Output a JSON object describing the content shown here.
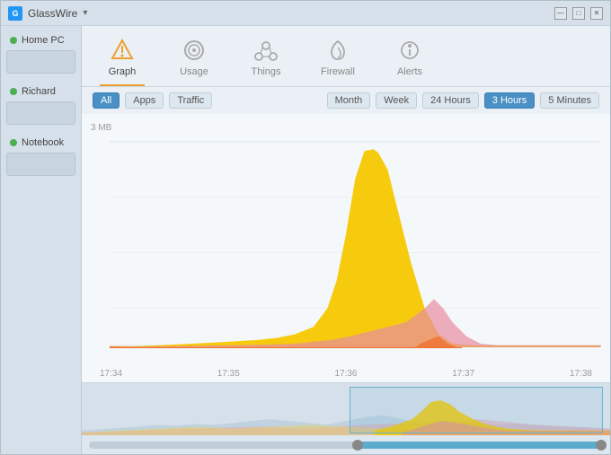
{
  "app": {
    "title": "GlassWire",
    "title_arrow": "▾"
  },
  "titlebar": {
    "minimize_label": "—",
    "maximize_label": "□",
    "close_label": "✕"
  },
  "sidebar": {
    "items": [
      {
        "id": "home-pc",
        "label": "Home PC",
        "status": "green"
      },
      {
        "id": "richard",
        "label": "Richard",
        "status": "green"
      },
      {
        "id": "notebook",
        "label": "Notebook",
        "status": "green"
      }
    ]
  },
  "nav": {
    "tabs": [
      {
        "id": "graph",
        "label": "Graph",
        "icon": "▲",
        "active": true
      },
      {
        "id": "usage",
        "label": "Usage",
        "icon": "◎"
      },
      {
        "id": "things",
        "label": "Things",
        "icon": "⬡"
      },
      {
        "id": "firewall",
        "label": "Firewall",
        "icon": "🔥"
      },
      {
        "id": "alerts",
        "label": "Alerts",
        "icon": "📍"
      }
    ]
  },
  "filters": {
    "type_buttons": [
      {
        "id": "all",
        "label": "All",
        "active": true
      },
      {
        "id": "apps",
        "label": "Apps",
        "active": false
      },
      {
        "id": "traffic",
        "label": "Traffic",
        "active": false
      }
    ],
    "time_buttons": [
      {
        "id": "month",
        "label": "Month",
        "active": false
      },
      {
        "id": "week",
        "label": "Week",
        "active": false
      },
      {
        "id": "24hours",
        "label": "24 Hours",
        "active": false
      },
      {
        "id": "3hours",
        "label": "3 Hours",
        "active": true
      },
      {
        "id": "5minutes",
        "label": "5 Minutes",
        "active": false
      }
    ]
  },
  "chart": {
    "y_label": "3 MB",
    "x_labels": [
      "17:34",
      "17:35",
      "17:36",
      "17:37",
      "17:38"
    ]
  },
  "colors": {
    "accent_orange": "#f0a030",
    "active_blue": "#4a90c4",
    "chart_yellow": "#f5c800",
    "chart_pink": "#e88ca0",
    "chart_orange": "#f07030",
    "timeline_blue": "#5aabcc"
  }
}
